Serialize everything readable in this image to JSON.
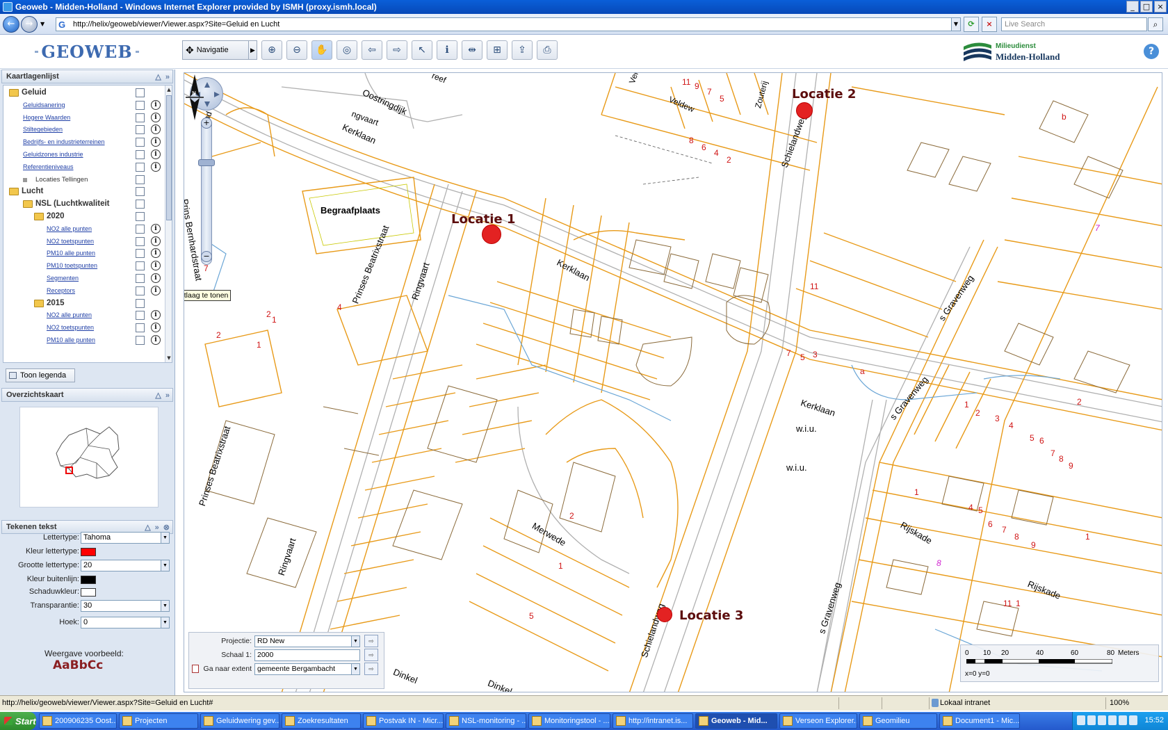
{
  "window": {
    "title": "Geoweb - Midden-Holland - Windows Internet Explorer provided by ISMH (proxy.ismh.local)"
  },
  "browser": {
    "url": "http://helix/geoweb/viewer/Viewer.aspx?Site=Geluid en Lucht",
    "search_placeholder": "Live Search"
  },
  "app": {
    "logo": "GEOWEB",
    "brand_top": "Milieudienst",
    "brand_bottom": "Midden-Holland",
    "nav_mode": "Navigatie",
    "help": "?"
  },
  "layerpanel": {
    "title": "Kaartlagenlijst",
    "items": [
      {
        "label": "Geluid",
        "type": "group",
        "level": 0,
        "info": false
      },
      {
        "label": "Geluidsanering",
        "type": "link",
        "level": 1,
        "info": true
      },
      {
        "label": "Hogere Waarden",
        "type": "link",
        "level": 1,
        "info": true
      },
      {
        "label": "Stiltegebieden",
        "type": "link",
        "level": 1,
        "info": true
      },
      {
        "label": "Bedrijfs- en industrieterreinen",
        "type": "link",
        "level": 1,
        "info": true
      },
      {
        "label": "Geluidzones industrie",
        "type": "link",
        "level": 1,
        "info": true
      },
      {
        "label": "Referentieniveaus",
        "type": "link",
        "level": 1,
        "info": true
      },
      {
        "label": "Locaties Tellingen",
        "type": "plain",
        "level": 1,
        "info": false
      },
      {
        "label": "Lucht",
        "type": "group",
        "level": 0,
        "info": false
      },
      {
        "label": "NSL (Luchtkwaliteit",
        "type": "group",
        "level": 1,
        "info": false
      },
      {
        "label": "2020",
        "type": "group",
        "level": 2,
        "info": false
      },
      {
        "label": "NO2 alle punten",
        "type": "link",
        "level": 3,
        "info": true
      },
      {
        "label": "NO2 toetspunten",
        "type": "link",
        "level": 3,
        "info": true
      },
      {
        "label": "PM10 alle punten",
        "type": "link",
        "level": 3,
        "info": true
      },
      {
        "label": "PM10 toetspunten",
        "type": "link",
        "level": 3,
        "info": true
      },
      {
        "label": "Segmenten",
        "type": "link",
        "level": 3,
        "info": true
      },
      {
        "label": "Receptors",
        "type": "link",
        "level": 3,
        "info": true
      },
      {
        "label": "2015",
        "type": "group",
        "level": 2,
        "info": false
      },
      {
        "label": "NO2 alle punten",
        "type": "link",
        "level": 3,
        "info": true
      },
      {
        "label": "NO2 toetspunten",
        "type": "link",
        "level": 3,
        "info": true
      },
      {
        "label": "PM10 alle punten",
        "type": "link",
        "level": 3,
        "info": true
      }
    ],
    "tooltip": "Klik om kaartlaag te tonen",
    "legend_button": "Toon legenda"
  },
  "overview": {
    "title": "Overzichtskaart"
  },
  "tekenen": {
    "title": "Tekenen tekst",
    "font_label": "Lettertype:",
    "font_value": "Tahoma",
    "fontcolor_label": "Kleur lettertype:",
    "fontcolor": "#ff0000",
    "size_label": "Grootte lettertype:",
    "size_value": "20",
    "outline_label": "Kleur buitenlijn:",
    "outline_color": "#000000",
    "shadow_label": "Schaduwkleur:",
    "shadow_color": "#ffffff",
    "transparency_label": "Transparantie:",
    "transparency_value": "30",
    "angle_label": "Hoek:",
    "angle_value": "0",
    "preview_label": "Weergave voorbeeld:",
    "preview_sample": "AaBbCc"
  },
  "map": {
    "locations": [
      "Locatie 1",
      "Locatie 2",
      "Locatie 3"
    ],
    "streets": {
      "kerklaan": "Kerklaan",
      "oostringdijk": "Oostringdijk",
      "ringvaart": "Ringvaart",
      "prinses_beatrixstraat": "Prinses Beatrixstraat",
      "prins_bernhardstraat": "Prins Bernhardstraat",
      "schielandweg": "Schielandweg",
      "s_gravenweg": "s Gravenweg",
      "rijskade": "Rijskade",
      "merwede": "Merwede",
      "zouterij": "Zouterij",
      "veldew": "Veldew",
      "dinkel": "Dinkel",
      "begraafplaats": "Begraafplaats",
      "wiu": "w.i.u.",
      "ringvaart_short": "ngvaart",
      "reef": "reef",
      "veldew_short": "Vel",
      "prins_short": "rand"
    },
    "house_numbers": [
      "11",
      "9",
      "7",
      "5",
      "8",
      "6",
      "4",
      "2",
      "11",
      "7",
      "5",
      "3",
      "a",
      "1",
      "2",
      "3",
      "4",
      "5",
      "6",
      "7",
      "8",
      "9",
      "1",
      "4",
      "5",
      "6",
      "7",
      "8",
      "9",
      "2",
      "1",
      "2",
      "4",
      "2",
      "1",
      "2",
      "1",
      "1",
      "5",
      "7",
      "b",
      "11",
      "1"
    ],
    "magenta_numbers": [
      "7",
      "8"
    ],
    "projection_label": "Projectie:",
    "projection_value": "RD New",
    "scale_label": "Schaal 1:",
    "scale_value": "2000",
    "extent_label": "Ga naar extent",
    "extent_value": "gemeente Bergambacht",
    "scale_ticks": [
      "0",
      "10",
      "20",
      "40",
      "60",
      "80"
    ],
    "scale_unit": "Meters",
    "coords": "x=0 y=0"
  },
  "status": {
    "text": "http://helix/geoweb/viewer/Viewer.aspx?Site=Geluid en Lucht#",
    "zone": "Lokaal intranet",
    "zoom": "100%"
  },
  "taskbar": {
    "start": "Start",
    "tasks": [
      {
        "label": "200906235 Oost...",
        "active": false
      },
      {
        "label": "Projecten",
        "active": false
      },
      {
        "label": "Geluidwering gev...",
        "active": false
      },
      {
        "label": "Zoekresultaten",
        "active": false
      },
      {
        "label": "Postvak IN - Micr...",
        "active": false
      },
      {
        "label": "NSL-monitoring - ...",
        "active": false
      },
      {
        "label": "Monitoringstool - ...",
        "active": false
      },
      {
        "label": "http://intranet.is...",
        "active": false
      },
      {
        "label": "Geoweb - Mid...",
        "active": true
      },
      {
        "label": "Verseon Explorer...",
        "active": false
      },
      {
        "label": "Geomilieu",
        "active": false
      },
      {
        "label": "Document1 - Mic...",
        "active": false
      }
    ],
    "clock": "15:52"
  }
}
